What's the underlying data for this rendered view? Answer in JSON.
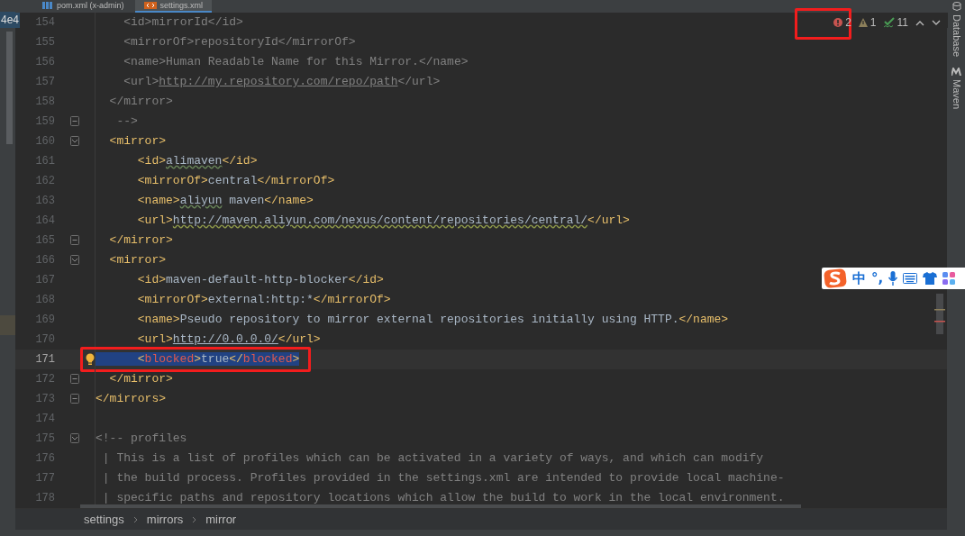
{
  "tabs": [
    {
      "label": "pom.xml (x-admin)",
      "selected": false
    },
    {
      "label": "settings.xml",
      "selected": true
    }
  ],
  "left_strip": {
    "label": "4e4"
  },
  "inspections": {
    "errors": "2",
    "warnings": "1",
    "passed": "11",
    "boxed": true
  },
  "right_tools": [
    {
      "label": "Database"
    },
    {
      "label": "Maven"
    }
  ],
  "lines": [
    {
      "number": "154",
      "segments": [
        {
          "kind": "ctag",
          "t": "    <id>"
        },
        {
          "kind": "ctext",
          "t": "mirrorId"
        },
        {
          "kind": "ctag",
          "t": "</id>"
        }
      ]
    },
    {
      "number": "155",
      "segments": [
        {
          "kind": "ctag",
          "t": "    <mirrorOf>"
        },
        {
          "kind": "ctext",
          "t": "repositoryId"
        },
        {
          "kind": "ctag",
          "t": "</mirrorOf>"
        }
      ]
    },
    {
      "number": "156",
      "segments": [
        {
          "kind": "ctag",
          "t": "    <name>"
        },
        {
          "kind": "ctext",
          "t": "Human Readable Name for this Mirror."
        },
        {
          "kind": "ctag",
          "t": "</name>"
        }
      ]
    },
    {
      "number": "157",
      "segments": [
        {
          "kind": "ctag",
          "t": "    <url>"
        },
        {
          "kind": "curl",
          "t": "http://my.repository.com/repo/path"
        },
        {
          "kind": "ctag",
          "t": "</url>"
        }
      ]
    },
    {
      "number": "158",
      "segments": [
        {
          "kind": "ctag",
          "t": "  </mirror>"
        }
      ]
    },
    {
      "number": "159",
      "fold_end": true,
      "segments": [
        {
          "kind": "ctag",
          "t": "   -->"
        }
      ]
    },
    {
      "number": "160",
      "fold_start": true,
      "segments": [
        {
          "kind": "tag",
          "t": "  <mirror>"
        }
      ]
    },
    {
      "number": "161",
      "segments": [
        {
          "kind": "tag",
          "t": "      <id>"
        },
        {
          "kind": "typo",
          "t": "alimaven"
        },
        {
          "kind": "tag",
          "t": "</id>"
        }
      ]
    },
    {
      "number": "162",
      "segments": [
        {
          "kind": "tag",
          "t": "      <mirrorOf>"
        },
        {
          "kind": "text",
          "t": "central"
        },
        {
          "kind": "tag",
          "t": "</mirrorOf>"
        }
      ]
    },
    {
      "number": "163",
      "segments": [
        {
          "kind": "tag",
          "t": "      <name>"
        },
        {
          "kind": "typo",
          "t": "aliyun"
        },
        {
          "kind": "text",
          "t": " maven"
        },
        {
          "kind": "tag",
          "t": "</name>"
        }
      ]
    },
    {
      "number": "164",
      "segments": [
        {
          "kind": "tag",
          "t": "      <url>"
        },
        {
          "kind": "wurl",
          "t": "http://maven.aliyun.com/nexus/content/repositories/central/"
        },
        {
          "kind": "tag",
          "t": "</url>"
        }
      ]
    },
    {
      "number": "165",
      "fold_end": true,
      "segments": [
        {
          "kind": "tag",
          "t": "  </mirror>"
        }
      ]
    },
    {
      "number": "166",
      "fold_start": true,
      "segments": [
        {
          "kind": "tag",
          "t": "  <mirror>"
        }
      ]
    },
    {
      "number": "167",
      "segments": [
        {
          "kind": "tag",
          "t": "      <id>"
        },
        {
          "kind": "text",
          "t": "maven-default-http-blocker"
        },
        {
          "kind": "tag",
          "t": "</id>"
        }
      ]
    },
    {
      "number": "168",
      "segments": [
        {
          "kind": "tag",
          "t": "      <mirrorOf>"
        },
        {
          "kind": "text",
          "t": "external:http:*"
        },
        {
          "kind": "tag",
          "t": "</mirrorOf>"
        }
      ]
    },
    {
      "number": "169",
      "segments": [
        {
          "kind": "tag",
          "t": "      <name>"
        },
        {
          "kind": "text",
          "t": "Pseudo repository to mirror external repositories initially using HTTP."
        },
        {
          "kind": "tag",
          "t": "</name>"
        }
      ]
    },
    {
      "number": "170",
      "segments": [
        {
          "kind": "tag",
          "t": "      <url>"
        },
        {
          "kind": "url",
          "t": "http://0.0.0.0/"
        },
        {
          "kind": "tag",
          "t": "</url>"
        }
      ]
    },
    {
      "number": "171",
      "current": true,
      "selected": true,
      "boxed": true,
      "bulb": true,
      "segments": [
        {
          "kind": "tag",
          "t": "      <"
        },
        {
          "kind": "bad",
          "t": "blocked"
        },
        {
          "kind": "tag",
          "t": ">"
        },
        {
          "kind": "text",
          "t": "true"
        },
        {
          "kind": "tag",
          "t": "</"
        },
        {
          "kind": "bad",
          "t": "blocked"
        },
        {
          "kind": "tag",
          "t": ">"
        }
      ]
    },
    {
      "number": "172",
      "fold_end": true,
      "segments": [
        {
          "kind": "tag",
          "t": "  </mirror>"
        }
      ]
    },
    {
      "number": "173",
      "fold_end": true,
      "segments": [
        {
          "kind": "tag",
          "t": "</mirrors>"
        }
      ]
    },
    {
      "number": "174"
    },
    {
      "number": "175",
      "fold_start": true,
      "segments": [
        {
          "kind": "comment",
          "t": "<!-- profiles"
        }
      ]
    },
    {
      "number": "176",
      "segments": [
        {
          "kind": "comment",
          "t": " | This is a list of profiles which can be activated in a variety of ways, and which can modify"
        }
      ]
    },
    {
      "number": "177",
      "segments": [
        {
          "kind": "comment",
          "t": " | the build process. Profiles provided in the settings.xml are intended to provide local machine-"
        }
      ]
    },
    {
      "number": "178",
      "segments": [
        {
          "kind": "comment",
          "t": " | specific paths and repository locations which allow the build to work in the local environment."
        }
      ]
    }
  ],
  "breadcrumbs": [
    "settings",
    "mirrors",
    "mirror"
  ],
  "ime_bar": {
    "mode": "中",
    "punctuation": "°,"
  }
}
